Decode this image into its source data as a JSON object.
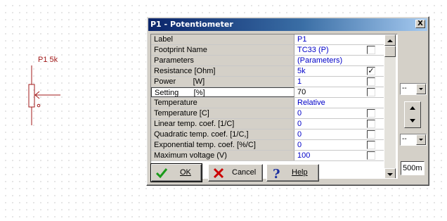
{
  "schematic": {
    "component_label": "P1 5k",
    "wire_color": "#a01818"
  },
  "dialog": {
    "title": "P1 - Potentiometer",
    "close_glyph": "X",
    "properties": [
      {
        "name": "Label",
        "value": "P1",
        "checkbox": "none"
      },
      {
        "name": "Footprint Name",
        "value": "TC33 (P)",
        "checkbox": "unchecked"
      },
      {
        "name": "Parameters",
        "value": "(Parameters)",
        "checkbox": "none"
      },
      {
        "name": "Resistance [Ohm]",
        "value": "5k",
        "checkbox": "checked"
      },
      {
        "name": "Power        [W]",
        "value": "1",
        "checkbox": "unchecked"
      },
      {
        "name": "Setting       [%]",
        "value": "70",
        "checkbox": "unchecked",
        "selected": true
      },
      {
        "name": "Temperature",
        "value": "Relative",
        "checkbox": "none"
      },
      {
        "name": "Temperature [C]",
        "value": "0",
        "checkbox": "unchecked"
      },
      {
        "name": "Linear temp. coef. [1/C]",
        "value": "0",
        "checkbox": "unchecked"
      },
      {
        "name": "Quadratic temp. coef. [1/C,]",
        "value": "0",
        "checkbox": "unchecked"
      },
      {
        "name": "Exponential temp. coef. [%/C]",
        "value": "0",
        "checkbox": "unchecked"
      },
      {
        "name": "Maximum voltage (V)",
        "value": "100",
        "checkbox": "unchecked"
      }
    ],
    "side_panel": {
      "combo_top": "--",
      "combo_bottom": "--",
      "step_value": "500m"
    },
    "buttons": {
      "ok": {
        "label": "OK",
        "icon": "checkmark-icon"
      },
      "cancel": {
        "label": "Cancel",
        "icon": "x-icon"
      },
      "help": {
        "label": "Help",
        "icon": "question-icon"
      }
    },
    "colors": {
      "value_text": "#0000c8",
      "titlebar_start": "#0a246a",
      "titlebar_end": "#a6caf0",
      "ok_icon": "#1a9a1a",
      "cancel_icon": "#cc0000",
      "help_icon": "#1a2fa0"
    }
  }
}
